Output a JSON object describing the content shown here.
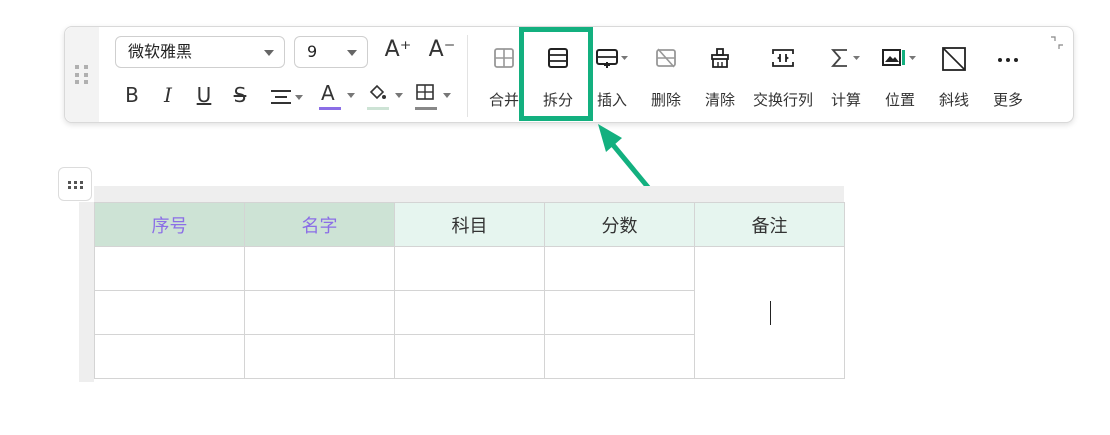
{
  "toolbar": {
    "font_family": "微软雅黑",
    "font_size": "9",
    "format": {
      "bold": "B",
      "italic": "I",
      "underline": "U",
      "strike": "S",
      "font_color_letter": "A",
      "grow_font": "A⁺",
      "shrink_font": "A⁻"
    },
    "colors": {
      "font_color": "#8b6ee6",
      "fill_color": "#cde3d5",
      "border_color": "#888888",
      "highlight": "#13b07f"
    },
    "tools": [
      {
        "label": "合并",
        "icon": "merge-cells-icon"
      },
      {
        "label": "拆分",
        "icon": "split-cells-icon"
      },
      {
        "label": "插入",
        "icon": "insert-icon"
      },
      {
        "label": "删除",
        "icon": "delete-icon"
      },
      {
        "label": "清除",
        "icon": "clear-icon"
      },
      {
        "label": "交换行列",
        "icon": "swap-rows-cols-icon"
      },
      {
        "label": "计算",
        "icon": "sigma-icon"
      },
      {
        "label": "位置",
        "icon": "position-icon"
      },
      {
        "label": "斜线",
        "icon": "diagonal-line-icon"
      },
      {
        "label": "更多",
        "icon": "more-icon"
      }
    ]
  },
  "table": {
    "headers": [
      "序号",
      "名字",
      "科目",
      "分数",
      "备注"
    ],
    "rows": [
      [
        "",
        "",
        "",
        ""
      ],
      [
        "",
        "",
        "",
        ""
      ],
      [
        "",
        "",
        "",
        ""
      ]
    ],
    "merged_note": ""
  }
}
